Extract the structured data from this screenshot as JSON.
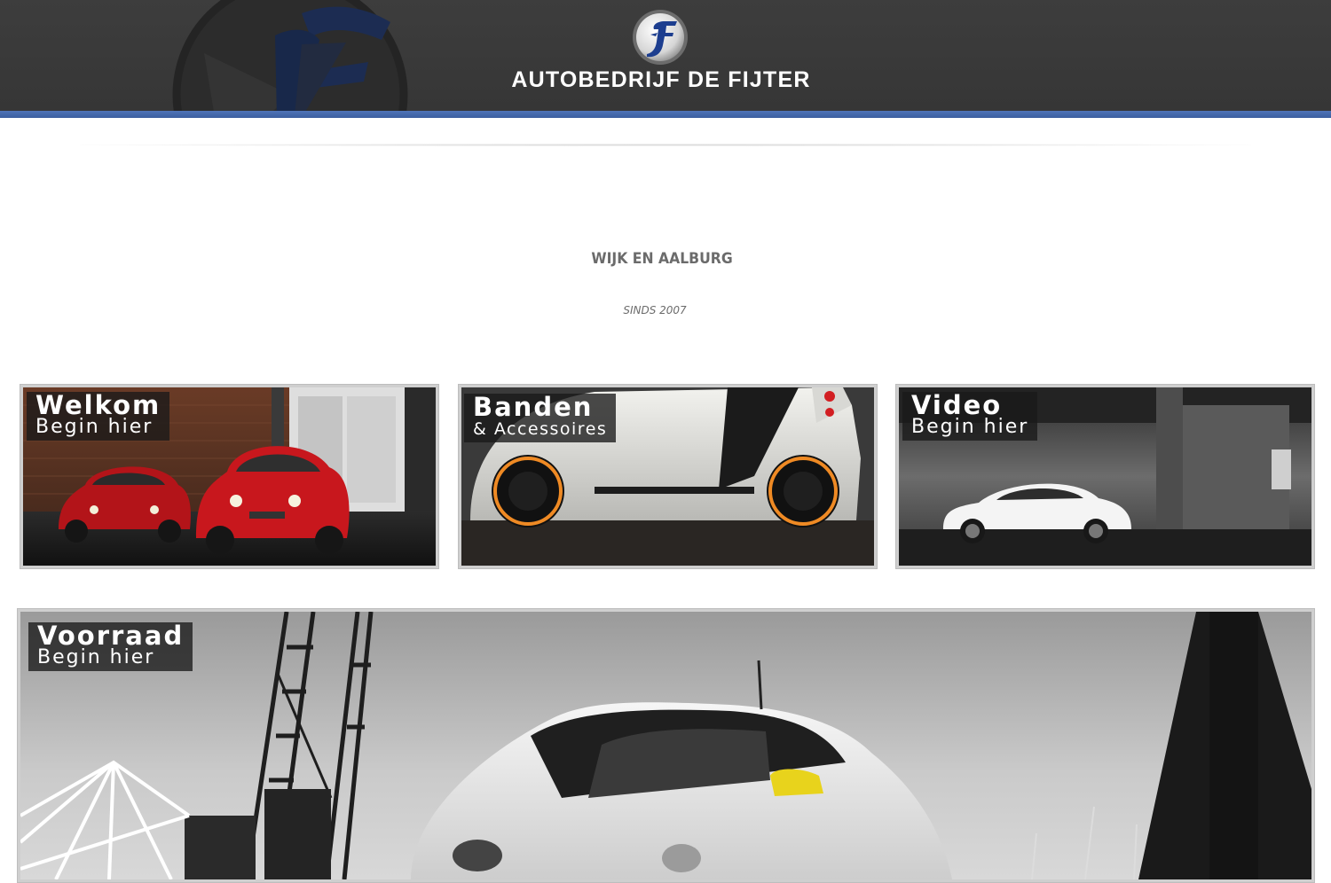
{
  "header": {
    "brand_name": "AUTOBEDRIJF DE FIJTER",
    "logo_letters": "JF",
    "stripe_color": "#4569ad",
    "background_color": "#3a3a3a"
  },
  "intro": {
    "location": "WIJK EN AALBURG",
    "since": "SINDS 2007"
  },
  "tiles": [
    {
      "id": "welkom",
      "title": "Welkom",
      "subtitle": "Begin hier",
      "icon": "red-fiat-cars"
    },
    {
      "id": "banden",
      "title": "Banden",
      "subtitle": "& Accessoires",
      "icon": "smart-car-orange-wheels"
    },
    {
      "id": "video",
      "title": "Video",
      "subtitle": "Begin hier",
      "icon": "white-coupe-garage"
    },
    {
      "id": "voorraad",
      "title": "Voorraad",
      "subtitle": "Begin hier",
      "icon": "smart-car-harbor-cranes"
    }
  ]
}
